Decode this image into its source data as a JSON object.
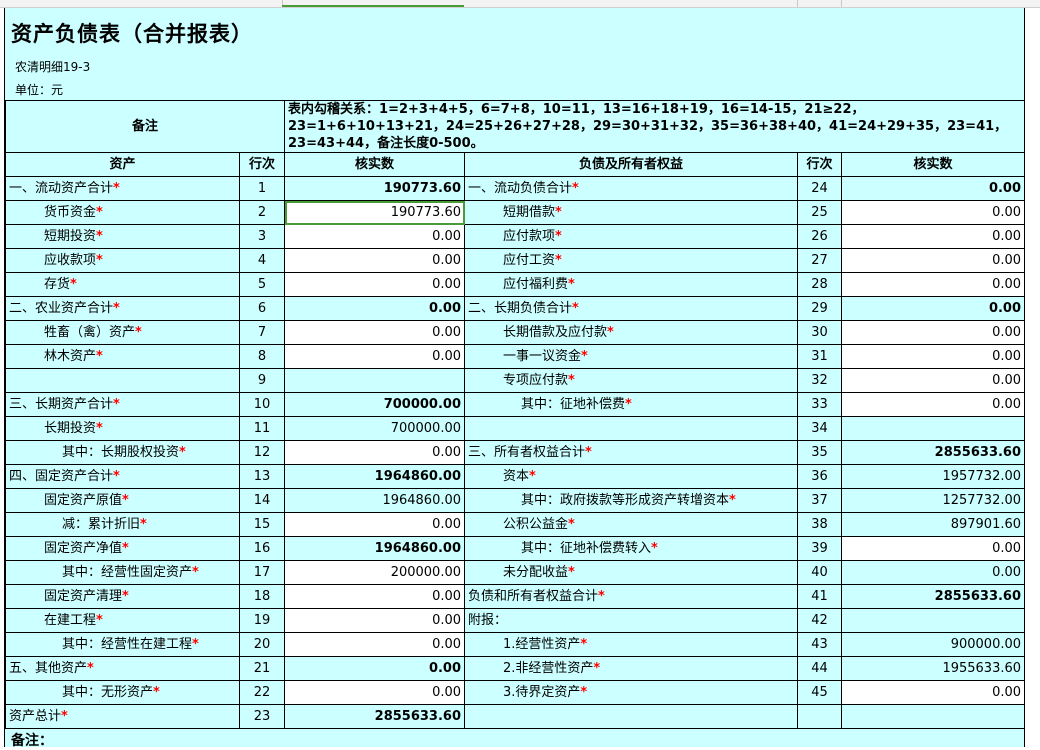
{
  "title": "资产负债表（合并报表）",
  "subtitle": "农清明细19-3",
  "unit": "单位：元",
  "remark_label": "备注",
  "relation_prefix": "表内勾稽关系：",
  "relation_text": "1=2+3+4+5，6=7+8，10=11，13=16+18+19，16=14-15，21≥22，23=1+6+10+13+21，24=25+26+27+28，29=30+31+32，35=36+38+40，41=24+29+35，23=41，23=43+44，备注长度0-500。",
  "headers": {
    "asset": "资产",
    "line1": "行次",
    "val1": "核实数",
    "liab": "负债及所有者权益",
    "line2": "行次",
    "val2": "核实数"
  },
  "rows": [
    {
      "l": {
        "label": "一、流动资产合计",
        "star": "*",
        "indent": 0,
        "line": "1",
        "value": "190773.60",
        "bold": true
      },
      "r": {
        "label": "一、流动负债合计",
        "star": "*",
        "indent": 0,
        "line": "24",
        "value": "0.00",
        "bold": true
      }
    },
    {
      "l": {
        "label": "货币资金",
        "star": "*",
        "indent": 1,
        "line": "2",
        "value": "190773.60",
        "white": true,
        "sel": true
      },
      "r": {
        "label": "短期借款",
        "star": "*",
        "indent": 1,
        "line": "25",
        "value": "0.00",
        "white": true
      }
    },
    {
      "l": {
        "label": "短期投资",
        "star": "*",
        "indent": 1,
        "line": "3",
        "value": "0.00",
        "white": true
      },
      "r": {
        "label": "应付款项",
        "star": "*",
        "indent": 1,
        "line": "26",
        "value": "0.00",
        "white": true
      }
    },
    {
      "l": {
        "label": "应收款项",
        "star": "*",
        "indent": 1,
        "line": "4",
        "value": "0.00",
        "white": true
      },
      "r": {
        "label": "应付工资",
        "star": "*",
        "indent": 1,
        "line": "27",
        "value": "0.00",
        "white": true
      }
    },
    {
      "l": {
        "label": "存货",
        "star": "*",
        "indent": 1,
        "line": "5",
        "value": "0.00",
        "white": true
      },
      "r": {
        "label": "应付福利费",
        "star": "*",
        "indent": 1,
        "line": "28",
        "value": "0.00",
        "white": true
      }
    },
    {
      "l": {
        "label": "二、农业资产合计",
        "star": "*",
        "indent": 0,
        "line": "6",
        "value": "0.00",
        "bold": true
      },
      "r": {
        "label": "二、长期负债合计",
        "star": "*",
        "indent": 0,
        "line": "29",
        "value": "0.00",
        "bold": true
      }
    },
    {
      "l": {
        "label": "牲畜（禽）资产",
        "star": "*",
        "indent": 1,
        "line": "7",
        "value": "0.00",
        "white": true
      },
      "r": {
        "label": "长期借款及应付款",
        "star": "*",
        "indent": 1,
        "line": "30",
        "value": "0.00",
        "white": true
      }
    },
    {
      "l": {
        "label": "林木资产",
        "star": "*",
        "indent": 1,
        "line": "8",
        "value": "0.00",
        "white": true
      },
      "r": {
        "label": "一事一议资金",
        "star": "*",
        "indent": 1,
        "line": "31",
        "value": "0.00",
        "white": true
      }
    },
    {
      "l": {
        "label": "",
        "star": "",
        "indent": 0,
        "line": "9",
        "value": ""
      },
      "r": {
        "label": "专项应付款",
        "star": "*",
        "indent": 1,
        "line": "32",
        "value": "0.00",
        "white": true
      }
    },
    {
      "l": {
        "label": "三、长期资产合计",
        "star": "*",
        "indent": 0,
        "line": "10",
        "value": "700000.00",
        "bold": true
      },
      "r": {
        "label": "其中：征地补偿费",
        "star": "*",
        "indent": 2,
        "line": "33",
        "value": "0.00",
        "white": true
      }
    },
    {
      "l": {
        "label": "长期投资",
        "star": "*",
        "indent": 1,
        "line": "11",
        "value": "700000.00"
      },
      "r": {
        "label": "",
        "star": "",
        "indent": 0,
        "line": "34",
        "value": ""
      }
    },
    {
      "l": {
        "label": "其中：长期股权投资",
        "star": "*",
        "indent": 2,
        "line": "12",
        "value": "0.00",
        "white": true
      },
      "r": {
        "label": "三、所有者权益合计",
        "star": "*",
        "indent": 0,
        "line": "35",
        "value": "2855633.60",
        "bold": true
      }
    },
    {
      "l": {
        "label": "四、固定资产合计",
        "star": "*",
        "indent": 0,
        "line": "13",
        "value": "1964860.00",
        "bold": true
      },
      "r": {
        "label": "资本",
        "star": "*",
        "indent": 1,
        "line": "36",
        "value": "1957732.00"
      }
    },
    {
      "l": {
        "label": "固定资产原值",
        "star": "*",
        "indent": 1,
        "line": "14",
        "value": "1964860.00"
      },
      "r": {
        "label": "其中：政府拨款等形成资产转增资本",
        "star": "*",
        "indent": 2,
        "line": "37",
        "value": "1257732.00"
      }
    },
    {
      "l": {
        "label": "减：累计折旧",
        "star": "*",
        "indent": 2,
        "line": "15",
        "value": "0.00",
        "white": true
      },
      "r": {
        "label": "公积公益金",
        "star": "*",
        "indent": 1,
        "line": "38",
        "value": "897901.60"
      }
    },
    {
      "l": {
        "label": "固定资产净值",
        "star": "*",
        "indent": 1,
        "line": "16",
        "value": "1964860.00",
        "bold": true
      },
      "r": {
        "label": "其中：征地补偿费转入",
        "star": "*",
        "indent": 2,
        "line": "39",
        "value": "0.00",
        "white": true
      }
    },
    {
      "l": {
        "label": "其中：经营性固定资产",
        "star": "*",
        "indent": 2,
        "line": "17",
        "value": "200000.00",
        "white": true
      },
      "r": {
        "label": "未分配收益",
        "star": "*",
        "indent": 1,
        "line": "40",
        "value": "0.00"
      }
    },
    {
      "l": {
        "label": "固定资产清理",
        "star": "*",
        "indent": 1,
        "line": "18",
        "value": "0.00",
        "white": true
      },
      "r": {
        "label": "负债和所有者权益合计",
        "star": "*",
        "indent": 0,
        "line": "41",
        "value": "2855633.60",
        "bold": true
      }
    },
    {
      "l": {
        "label": "在建工程",
        "star": "*",
        "indent": 1,
        "line": "19",
        "value": "0.00",
        "white": true
      },
      "r": {
        "label": "附报：",
        "star": "",
        "indent": 0,
        "line": "42",
        "value": ""
      }
    },
    {
      "l": {
        "label": "其中：经营性在建工程",
        "star": "*",
        "indent": 2,
        "line": "20",
        "value": "0.00",
        "white": true
      },
      "r": {
        "label": "1.经营性资产",
        "star": "*",
        "indent": 1,
        "line": "43",
        "value": "900000.00"
      }
    },
    {
      "l": {
        "label": "五、其他资产",
        "star": "*",
        "indent": 0,
        "line": "21",
        "value": "0.00",
        "bold": true
      },
      "r": {
        "label": "2.非经营性资产",
        "star": "*",
        "indent": 1,
        "line": "44",
        "value": "1955633.60"
      }
    },
    {
      "l": {
        "label": "其中：无形资产",
        "star": "*",
        "indent": 2,
        "line": "22",
        "value": "0.00",
        "white": true
      },
      "r": {
        "label": "3.待界定资产",
        "star": "*",
        "indent": 1,
        "line": "45",
        "value": "0.00",
        "white": true
      }
    },
    {
      "l": {
        "label": "资产总计",
        "star": "*",
        "indent": 0,
        "line": "23",
        "value": "2855633.60",
        "bold": true
      },
      "r": {
        "label": "",
        "star": "",
        "indent": 0,
        "line": "",
        "value": ""
      }
    }
  ],
  "footnote": "备注："
}
